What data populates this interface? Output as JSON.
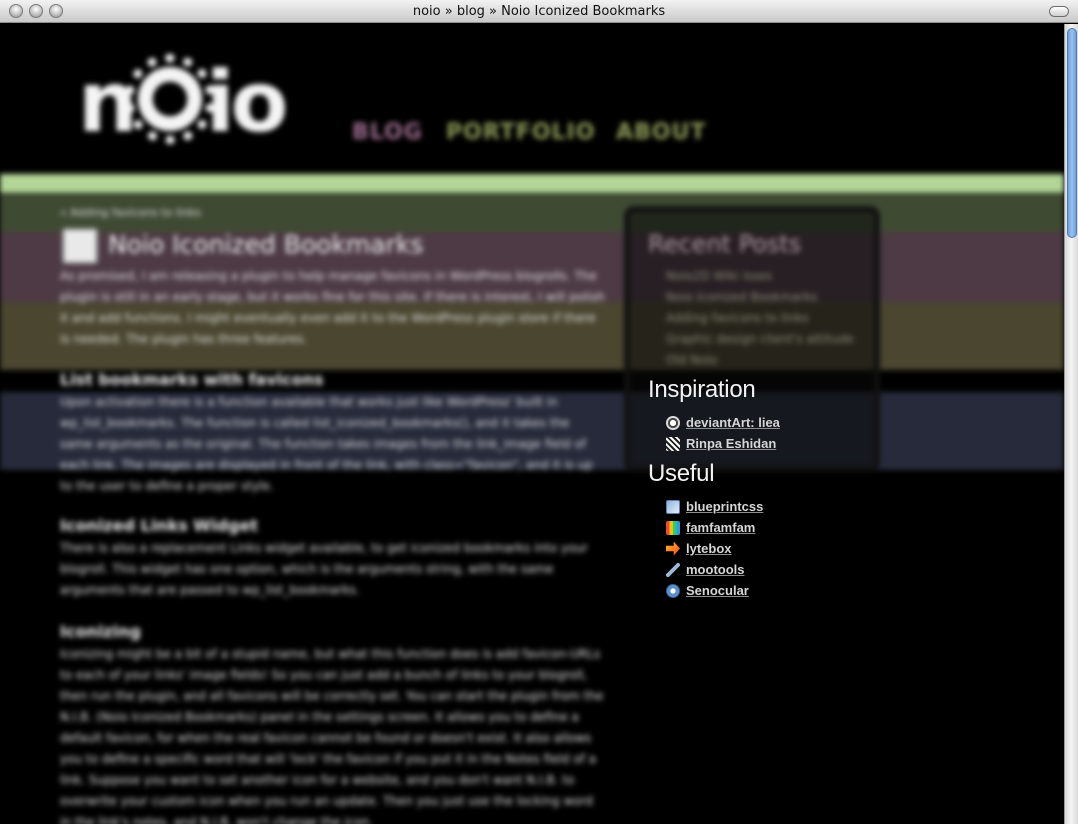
{
  "window": {
    "title": "noio » blog » Noio Iconized Bookmarks"
  },
  "header": {
    "logo": "noio",
    "nav": [
      {
        "label": "BLOG"
      },
      {
        "label": "PORTFOLIO"
      },
      {
        "label": "ABOUT"
      }
    ]
  },
  "main": {
    "backlink": "« Adding favicons to links",
    "post_title": "Noio Iconized Bookmarks",
    "paragraphs": [
      "As promised, I am releasing a plugin to help manage favicons in WordPress blogrolls. The plugin is still in an early stage, but it works fine for this site. If there is interest, I will polish it and add functions. I might eventually even add it to the WordPress plugin store if there is needed. The plugin has three features.",
      "Upon activation there is a function available that works just like WordPress' built in wp_list_bookmarks. The function is called list_iconized_bookmarks(), and it takes the same arguments as the original. The function takes images from the link_image field of each link. The images are displayed in front of the link, with class=\"favicon\", and it is up to the user to define a proper style.",
      "There is also a replacement Links widget available, to get iconized bookmarks into your blogroll. This widget has one option, which is the arguments string, with the same arguments that are passed to wp_list_bookmarks.",
      "Iconizing might be a bit of a stupid name, but what this function does is add favicon-URLs to each of your links' image fields! So you can just add a bunch of links to your blogroll, then run the plugin, and all favicons will be correctly set. You can start the plugin from the N.I.B. (Noio Iconized Bookmarks) panel in the settings screen. It allows you to define a default favicon, for when the real favicon cannot be found or doesn't exist. It also allows you to define a specific word that will 'lock' the favicon if you put it in the Notes field of a link. Suppose you want to set another icon for a website, and you don't want N.I.B. to overwrite your custom icon when you run an update. Then you just use the locking word in the link's notes, and N.I.B. won't change the icon."
    ],
    "headings": [
      "List bookmarks with favicons",
      "Iconized Links Widget",
      "Iconizing"
    ]
  },
  "sidebar": {
    "recent_title": "Recent Posts",
    "recent_posts": [
      "Noio2D Wiki isses",
      "Noio Iconized Bookmarks",
      "Adding favicons to links",
      "Graphic design client's attitude",
      "Old Noio"
    ],
    "inspiration_title": "Inspiration",
    "inspiration_links": [
      {
        "label": "deviantArt: liea",
        "icon": "deviantart-icon"
      },
      {
        "label": "Rinpa Eshidan",
        "icon": "rinpa-icon"
      }
    ],
    "useful_title": "Useful",
    "useful_links": [
      {
        "label": "blueprintcss",
        "icon": "blueprint-icon"
      },
      {
        "label": "famfamfam",
        "icon": "famfamfam-icon"
      },
      {
        "label": "lytebox",
        "icon": "lytebox-icon"
      },
      {
        "label": "mootools",
        "icon": "mootools-icon"
      },
      {
        "label": "Senocular",
        "icon": "senocular-icon"
      }
    ]
  }
}
